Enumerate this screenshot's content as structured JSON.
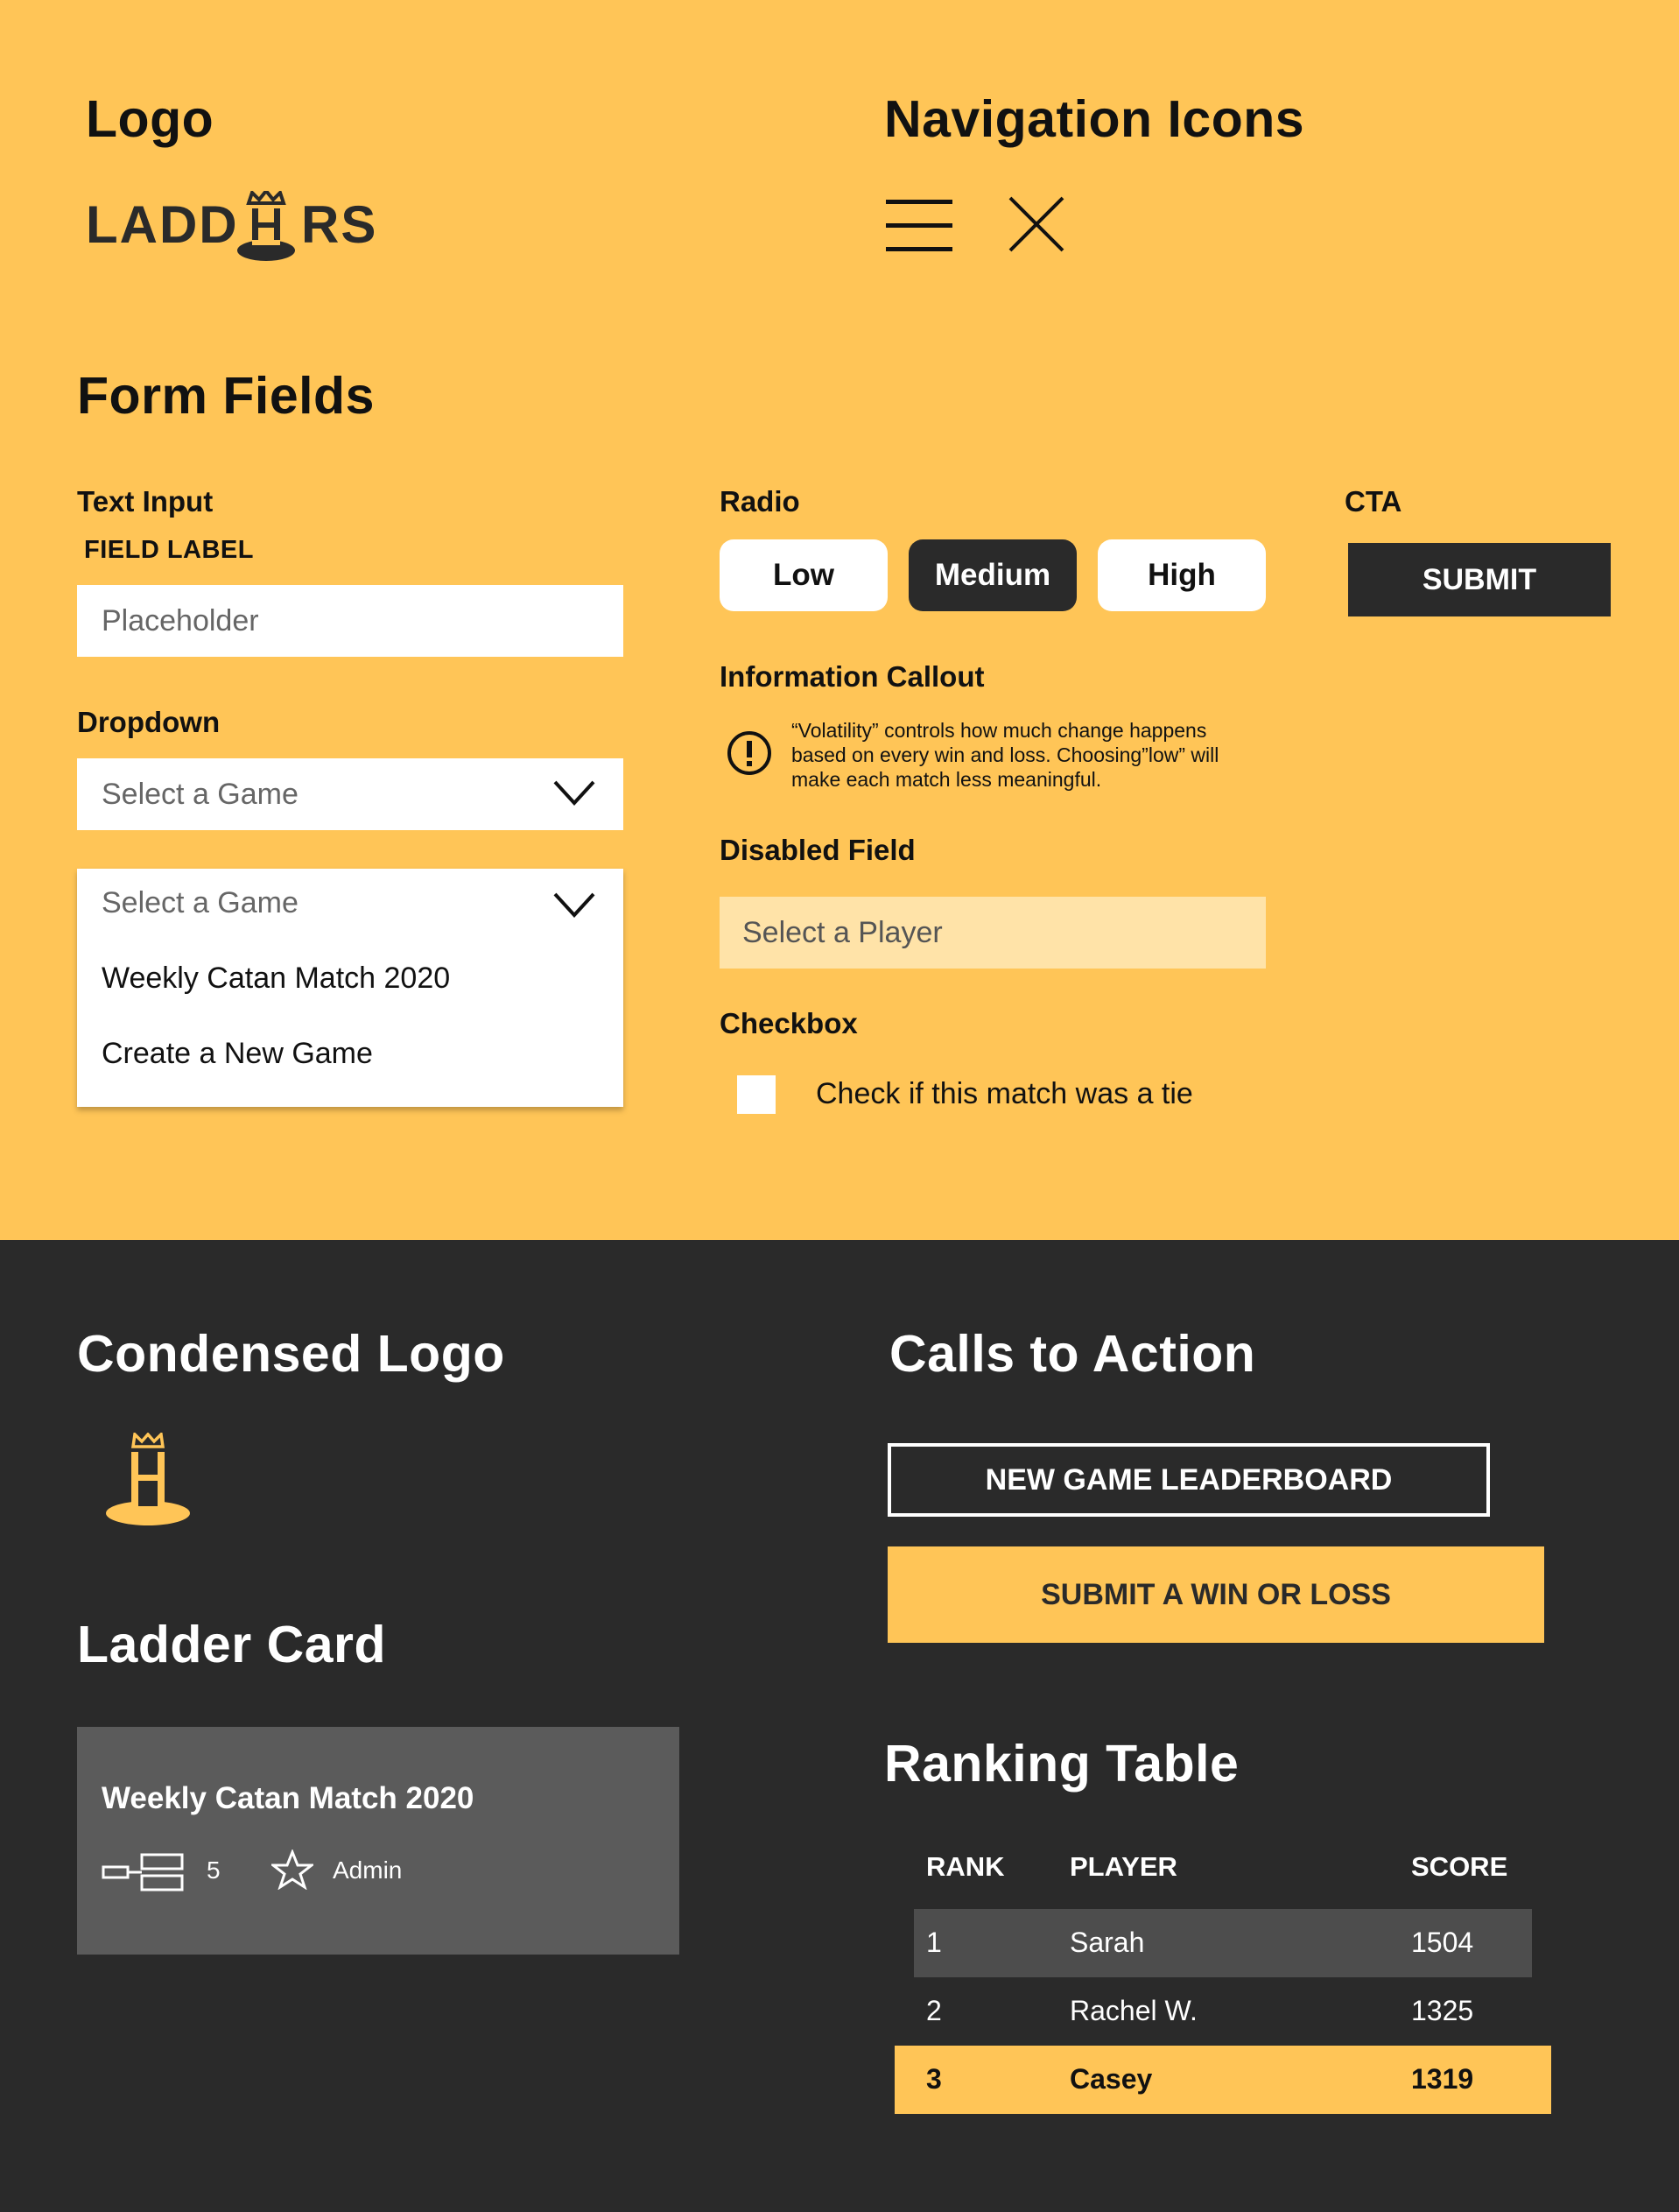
{
  "colors": {
    "brand_yellow": "#FFC557",
    "dark": "#2a2a2a",
    "card_gray": "#5b5b5b",
    "disabled_yellow": "#FFE3A8"
  },
  "logo_section": {
    "heading": "Logo",
    "wordmark_left": "LADD",
    "wordmark_right": "RS",
    "icon": "ladder-crown-icon"
  },
  "nav_icons": {
    "heading": "Navigation Icons",
    "icons": [
      "hamburger-menu-icon",
      "close-icon"
    ]
  },
  "form_fields": {
    "heading": "Form Fields",
    "text_input": {
      "section_label": "Text Input",
      "field_label": "FIELD LABEL",
      "placeholder": "Placeholder"
    },
    "dropdown": {
      "section_label": "Dropdown",
      "selected": "Select a Game",
      "open_selected": "Select a Game",
      "options": [
        "Weekly Catan Match 2020",
        "Create a New Game"
      ]
    },
    "radio": {
      "section_label": "Radio",
      "options": [
        "Low",
        "Medium",
        "High"
      ],
      "selected": "Medium"
    },
    "cta": {
      "section_label": "CTA",
      "button_label": "SUBMIT"
    },
    "callout": {
      "section_label": "Information Callout",
      "lines": [
        "“Volatility” controls how much change happens",
        "based on every win and loss. Choosing”low” will",
        "make each match less meaningful."
      ]
    },
    "disabled": {
      "section_label": "Disabled Field",
      "value": "Select a Player"
    },
    "checkbox": {
      "section_label": "Checkbox",
      "label": "Check if this match was a tie",
      "checked": false
    }
  },
  "condensed_logo": {
    "heading": "Condensed Logo"
  },
  "calls_to_action": {
    "heading": "Calls to Action",
    "outline_button": "NEW GAME LEADERBOARD",
    "filled_button": "SUBMIT A WIN OR LOSS"
  },
  "ladder_card": {
    "heading": "Ladder Card",
    "title": "Weekly Catan Match 2020",
    "bracket_count": "5",
    "role": "Admin"
  },
  "ranking_table": {
    "heading": "Ranking Table",
    "columns": [
      "RANK",
      "PLAYER",
      "SCORE"
    ],
    "rows": [
      {
        "rank": "1",
        "player": "Sarah",
        "score": "1504"
      },
      {
        "rank": "2",
        "player": "Rachel W.",
        "score": "1325"
      },
      {
        "rank": "3",
        "player": "Casey",
        "score": "1319"
      }
    ]
  }
}
